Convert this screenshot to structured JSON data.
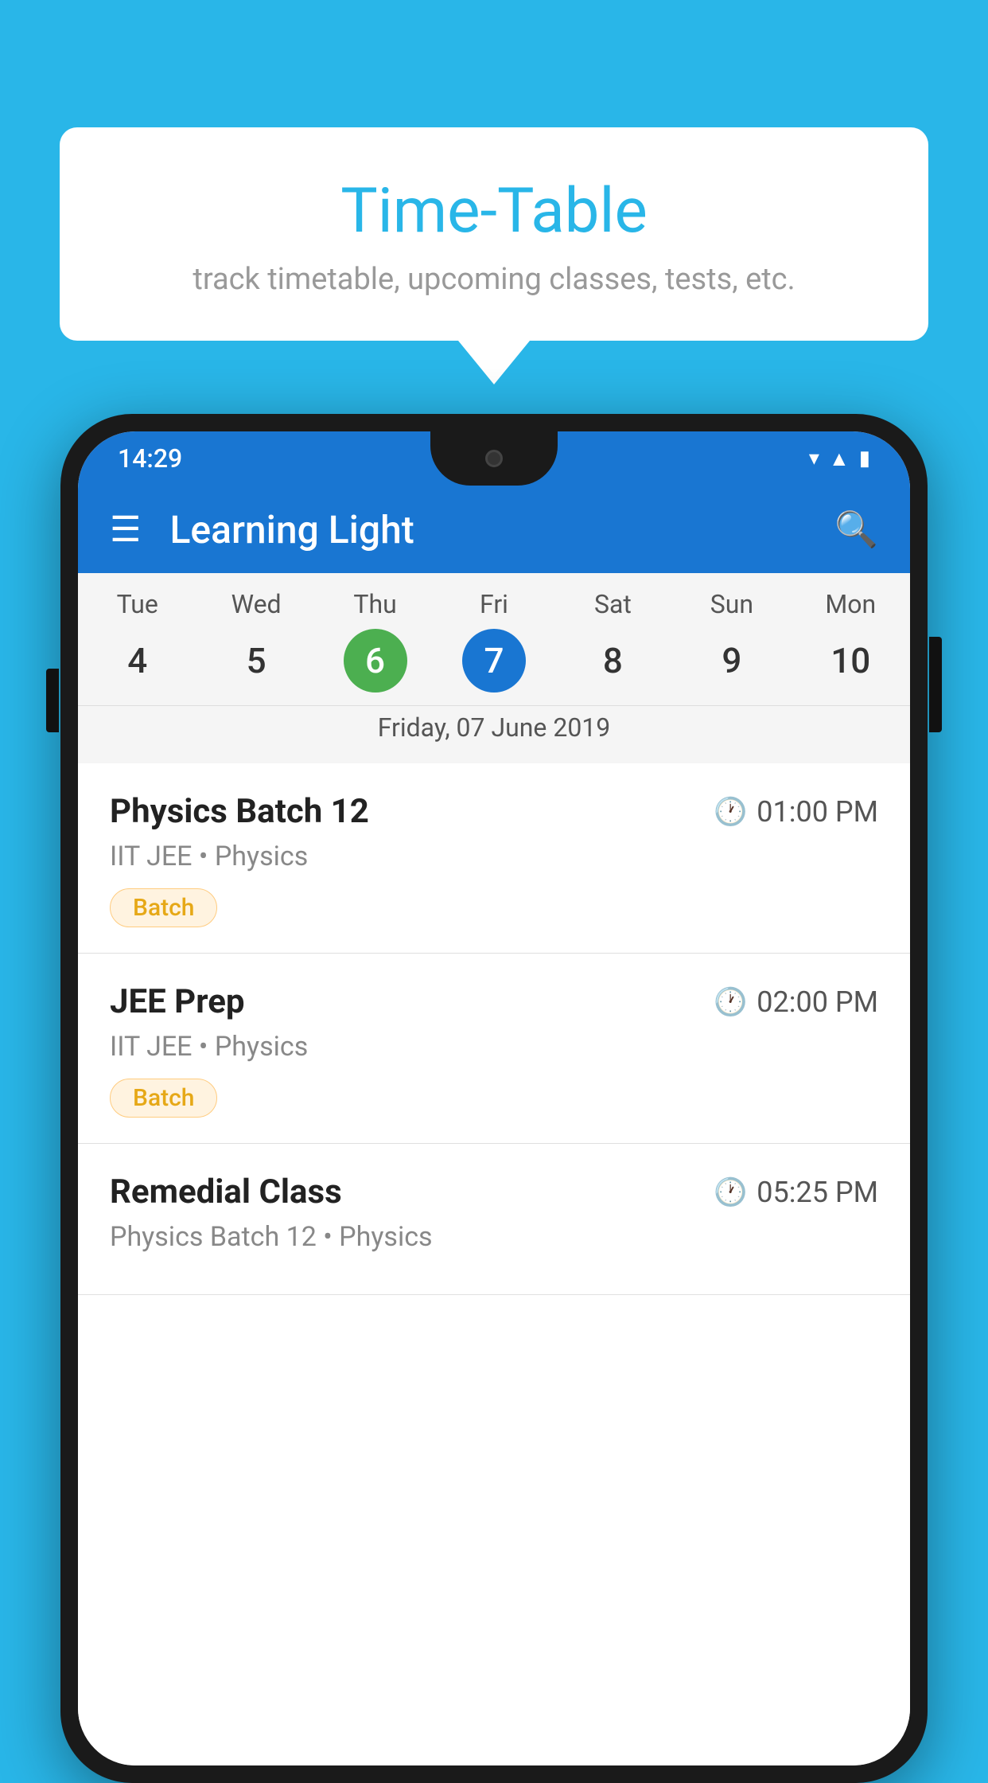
{
  "background": {
    "color": "#29B6E8"
  },
  "bubble": {
    "title": "Time-Table",
    "subtitle": "track timetable, upcoming classes, tests, etc."
  },
  "phone": {
    "statusBar": {
      "time": "14:29",
      "icons": [
        "wifi",
        "signal",
        "battery"
      ]
    },
    "appBar": {
      "title": "Learning Light"
    },
    "calendar": {
      "days": [
        {
          "name": "Tue",
          "number": "4",
          "state": "normal"
        },
        {
          "name": "Wed",
          "number": "5",
          "state": "normal"
        },
        {
          "name": "Thu",
          "number": "6",
          "state": "today"
        },
        {
          "name": "Fri",
          "number": "7",
          "state": "selected"
        },
        {
          "name": "Sat",
          "number": "8",
          "state": "normal"
        },
        {
          "name": "Sun",
          "number": "9",
          "state": "normal"
        },
        {
          "name": "Mon",
          "number": "10",
          "state": "normal"
        }
      ],
      "selectedDateLabel": "Friday, 07 June 2019"
    },
    "schedule": [
      {
        "title": "Physics Batch 12",
        "time": "01:00 PM",
        "subtitle": "IIT JEE • Physics",
        "tag": "Batch"
      },
      {
        "title": "JEE Prep",
        "time": "02:00 PM",
        "subtitle": "IIT JEE • Physics",
        "tag": "Batch"
      },
      {
        "title": "Remedial Class",
        "time": "05:25 PM",
        "subtitle": "Physics Batch 12 • Physics",
        "tag": null
      }
    ]
  }
}
